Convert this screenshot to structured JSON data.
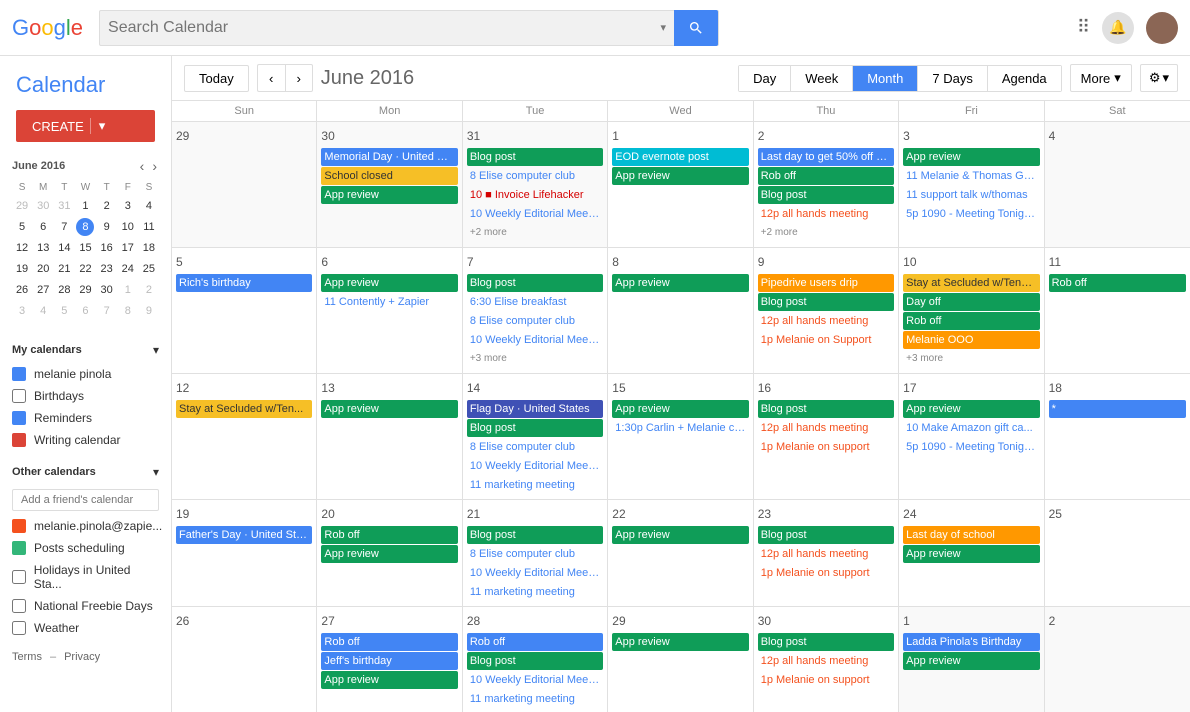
{
  "header": {
    "search_placeholder": "Search Calendar",
    "title": "Calendar"
  },
  "toolbar": {
    "today": "Today",
    "month_title": "June 2016",
    "views": [
      "Day",
      "Week",
      "Month",
      "7 Days",
      "Agenda"
    ],
    "active_view": "Month",
    "more": "More",
    "settings": "⚙"
  },
  "sidebar": {
    "calendar_title": "Calendar",
    "create_label": "CREATE",
    "mini_cal": {
      "title": "June 2016",
      "day_headers": [
        "S",
        "M",
        "T",
        "W",
        "T",
        "F",
        "S"
      ],
      "weeks": [
        [
          {
            "day": 29,
            "other": true
          },
          {
            "day": 30,
            "other": true
          },
          {
            "day": 31,
            "other": true
          },
          {
            "day": 1
          },
          {
            "day": 2
          },
          {
            "day": 3
          },
          {
            "day": 4
          }
        ],
        [
          {
            "day": 5
          },
          {
            "day": 6
          },
          {
            "day": 7
          },
          {
            "day": 8,
            "today": true
          },
          {
            "day": 9
          },
          {
            "day": 10
          },
          {
            "day": 11
          }
        ],
        [
          {
            "day": 12
          },
          {
            "day": 13
          },
          {
            "day": 14
          },
          {
            "day": 15
          },
          {
            "day": 16
          },
          {
            "day": 17
          },
          {
            "day": 18
          }
        ],
        [
          {
            "day": 19
          },
          {
            "day": 20
          },
          {
            "day": 21
          },
          {
            "day": 22
          },
          {
            "day": 23
          },
          {
            "day": 24
          },
          {
            "day": 25
          }
        ],
        [
          {
            "day": 26
          },
          {
            "day": 27
          },
          {
            "day": 28
          },
          {
            "day": 29
          },
          {
            "day": 30
          },
          {
            "day": 1,
            "other": true
          },
          {
            "day": 2,
            "other": true
          }
        ],
        [
          {
            "day": 3,
            "other": true
          },
          {
            "day": 4,
            "other": true
          },
          {
            "day": 5,
            "other": true
          },
          {
            "day": 6,
            "other": true
          },
          {
            "day": 7,
            "other": true
          },
          {
            "day": 8,
            "other": true
          },
          {
            "day": 9,
            "other": true
          }
        ]
      ]
    },
    "my_calendars_label": "My calendars",
    "my_calendars": [
      {
        "name": "melanie pinola",
        "color": "#4285F4",
        "checked": true
      },
      {
        "name": "Birthdays",
        "color": "",
        "checked": false
      },
      {
        "name": "Reminders",
        "color": "#4285F4",
        "checked": true
      },
      {
        "name": "Writing calendar",
        "color": "#DB4437",
        "checked": true
      }
    ],
    "other_calendars_label": "Other calendars",
    "add_friend_placeholder": "Add a friend's calendar",
    "other_calendars": [
      {
        "name": "melanie.pinola@zapie...",
        "color": "#F4511E",
        "checked": true
      },
      {
        "name": "Posts scheduling",
        "color": "#33B679",
        "checked": true
      },
      {
        "name": "Holidays in United Sta...",
        "color": "",
        "checked": false
      },
      {
        "name": "National Freebie Days",
        "color": "",
        "checked": false
      },
      {
        "name": "Weather",
        "color": "",
        "checked": false
      }
    ],
    "footer_terms": "Terms",
    "footer_privacy": "Privacy"
  },
  "calendar": {
    "day_headers": [
      "Sun",
      "Mon",
      "Tue",
      "Wed",
      "Thu",
      "Fri",
      "Sat"
    ],
    "weeks": [
      {
        "cells": [
          {
            "date": "29",
            "other": true,
            "events": []
          },
          {
            "date": "30",
            "other": true,
            "events": [
              {
                "text": "Memorial Day · United Sta...",
                "class": "event-blue-bg"
              },
              {
                "text": "School closed",
                "class": "event-yellow-bg"
              },
              {
                "text": "App review",
                "class": "event-green-bg"
              }
            ]
          },
          {
            "date": "31",
            "other": true,
            "events": [
              {
                "text": "Blog post",
                "class": "event-green-bg"
              },
              {
                "text": "8 Elise computer club",
                "class": "event-blue-text"
              },
              {
                "text": "10 ■ Invoice Lifehacker",
                "class": "event-red-text event-dot-red"
              },
              {
                "text": "10 Weekly Editorial Meeti...",
                "class": "event-blue-text"
              },
              {
                "text": "+2 more",
                "class": "event-more"
              }
            ]
          },
          {
            "date": "1",
            "events": [
              {
                "text": "EOD evernote post",
                "class": "event-teal-bg"
              },
              {
                "text": "App review",
                "class": "event-green-bg"
              }
            ]
          },
          {
            "date": "2",
            "events": [
              {
                "text": "Last day to get 50% off n...",
                "class": "event-blue-bg"
              },
              {
                "text": "Rob off",
                "class": "event-green-bg"
              },
              {
                "text": "Blog post",
                "class": "event-green-bg"
              },
              {
                "text": "12p all hands meeting",
                "class": "event-orange-text"
              },
              {
                "text": "+2 more",
                "class": "event-more"
              }
            ]
          },
          {
            "date": "3",
            "events": [
              {
                "text": "App review",
                "class": "event-green-bg"
              },
              {
                "text": "11 Melanie & Thomas Go...",
                "class": "event-blue-text"
              },
              {
                "text": "11 support talk w/thomas",
                "class": "event-blue-text"
              },
              {
                "text": "5p 1090 - Meeting Tonigh...",
                "class": "event-blue-text"
              }
            ]
          },
          {
            "date": "4",
            "other": true,
            "events": []
          }
        ]
      },
      {
        "cells": [
          {
            "date": "5",
            "events": [
              {
                "text": "Rich's birthday",
                "class": "event-blue-bg"
              }
            ]
          },
          {
            "date": "6",
            "events": [
              {
                "text": "App review",
                "class": "event-green-bg"
              },
              {
                "text": "11 Contently + Zapier",
                "class": "event-blue-text"
              }
            ]
          },
          {
            "date": "7",
            "events": [
              {
                "text": "Blog post",
                "class": "event-green-bg"
              },
              {
                "text": "6:30 Elise breakfast",
                "class": "event-blue-text"
              },
              {
                "text": "8 Elise computer club",
                "class": "event-blue-text"
              },
              {
                "text": "10 Weekly Editorial Meeti...",
                "class": "event-blue-text"
              },
              {
                "text": "+3 more",
                "class": "event-more"
              }
            ]
          },
          {
            "date": "8",
            "events": [
              {
                "text": "App review",
                "class": "event-green-bg"
              }
            ]
          },
          {
            "date": "9",
            "events": [
              {
                "text": "Pipedrive users drip",
                "class": "event-orange-bg"
              },
              {
                "text": "Blog post",
                "class": "event-green-bg"
              },
              {
                "text": "12p all hands meeting",
                "class": "event-orange-text"
              },
              {
                "text": "1p Melanie on Support",
                "class": "event-orange-text"
              }
            ]
          },
          {
            "date": "10",
            "events": [
              {
                "text": "Stay at Secluded w/Tennis/Koi Pond/Hot Tub - Secl",
                "class": "event-yellow-bg"
              },
              {
                "text": "Day off",
                "class": "event-green-bg"
              },
              {
                "text": "Rob off",
                "class": "event-green-bg"
              },
              {
                "text": "Melanie OOO",
                "class": "event-orange-bg"
              },
              {
                "text": "+3 more",
                "class": "event-more"
              }
            ]
          },
          {
            "date": "11",
            "events": [
              {
                "text": "Rob off",
                "class": "event-green-bg"
              }
            ]
          }
        ]
      },
      {
        "cells": [
          {
            "date": "12",
            "events": [
              {
                "text": "Stay at Secluded w/Ten...",
                "class": "event-yellow-bg"
              }
            ]
          },
          {
            "date": "13",
            "events": [
              {
                "text": "App review",
                "class": "event-green-bg"
              }
            ]
          },
          {
            "date": "14",
            "events": [
              {
                "text": "Flag Day · United States",
                "class": "event-flag-blue"
              },
              {
                "text": "Blog post",
                "class": "event-green-bg"
              },
              {
                "text": "8 Elise computer club",
                "class": "event-blue-text"
              },
              {
                "text": "10 Weekly Editorial Meeti...",
                "class": "event-blue-text"
              },
              {
                "text": "11 marketing meeting",
                "class": "event-blue-text"
              }
            ]
          },
          {
            "date": "15",
            "events": [
              {
                "text": "App review",
                "class": "event-green-bg"
              },
              {
                "text": "1:30p Carlin + Melanie ch...",
                "class": "event-blue-text"
              }
            ]
          },
          {
            "date": "16",
            "events": [
              {
                "text": "Blog post",
                "class": "event-green-bg"
              },
              {
                "text": "12p all hands meeting",
                "class": "event-orange-text"
              },
              {
                "text": "1p Melanie on support",
                "class": "event-orange-text"
              }
            ]
          },
          {
            "date": "17",
            "events": [
              {
                "text": "App review",
                "class": "event-green-bg"
              },
              {
                "text": "10 Make Amazon gift ca...",
                "class": "event-blue-text"
              },
              {
                "text": "5p 1090 - Meeting Tonigh...",
                "class": "event-blue-text"
              }
            ]
          },
          {
            "date": "18",
            "events": [
              {
                "text": "*",
                "class": "event-blue-bg"
              }
            ]
          }
        ]
      },
      {
        "cells": [
          {
            "date": "19",
            "events": [
              {
                "text": "Father's Day · United Stat...",
                "class": "event-fathers"
              }
            ]
          },
          {
            "date": "20",
            "events": [
              {
                "text": "Rob off",
                "class": "event-green-bg"
              },
              {
                "text": "App review",
                "class": "event-green-bg"
              }
            ]
          },
          {
            "date": "21",
            "events": [
              {
                "text": "Blog post",
                "class": "event-green-bg"
              },
              {
                "text": "8 Elise computer club",
                "class": "event-blue-text"
              },
              {
                "text": "10 Weekly Editorial Meeti...",
                "class": "event-blue-text"
              },
              {
                "text": "11 marketing meeting",
                "class": "event-blue-text"
              }
            ]
          },
          {
            "date": "22",
            "events": [
              {
                "text": "App review",
                "class": "event-green-bg"
              }
            ]
          },
          {
            "date": "23",
            "events": [
              {
                "text": "Blog post",
                "class": "event-green-bg"
              },
              {
                "text": "12p all hands meeting",
                "class": "event-orange-text"
              },
              {
                "text": "1p Melanie on support",
                "class": "event-orange-text"
              }
            ]
          },
          {
            "date": "24",
            "events": [
              {
                "text": "Last day of school",
                "class": "event-orange-bg"
              },
              {
                "text": "App review",
                "class": "event-green-bg"
              }
            ]
          },
          {
            "date": "25",
            "events": []
          }
        ]
      },
      {
        "cells": [
          {
            "date": "26",
            "events": []
          },
          {
            "date": "27",
            "events": [
              {
                "text": "Rob off",
                "class": "event-blue-bg"
              },
              {
                "text": "Jeff's birthday",
                "class": "event-blue-bg"
              },
              {
                "text": "App review",
                "class": "event-green-bg"
              }
            ]
          },
          {
            "date": "28",
            "events": [
              {
                "text": "Rob off",
                "class": "event-blue-bg"
              },
              {
                "text": "Blog post",
                "class": "event-green-bg"
              },
              {
                "text": "10 Weekly Editorial Meeti...",
                "class": "event-blue-text"
              },
              {
                "text": "11 marketing meeting",
                "class": "event-blue-text"
              }
            ]
          },
          {
            "date": "29",
            "events": [
              {
                "text": "App review",
                "class": "event-green-bg"
              }
            ]
          },
          {
            "date": "30",
            "events": [
              {
                "text": "Blog post",
                "class": "event-green-bg"
              },
              {
                "text": "12p all hands meeting",
                "class": "event-orange-text"
              },
              {
                "text": "1p Melanie on support",
                "class": "event-orange-text"
              }
            ]
          },
          {
            "date": "1",
            "other": true,
            "events": [
              {
                "text": "Ladda Pinola's Birthday",
                "class": "event-blue-bg"
              },
              {
                "text": "App review",
                "class": "event-green-bg"
              }
            ]
          },
          {
            "date": "2",
            "other": true,
            "events": []
          }
        ]
      }
    ]
  }
}
